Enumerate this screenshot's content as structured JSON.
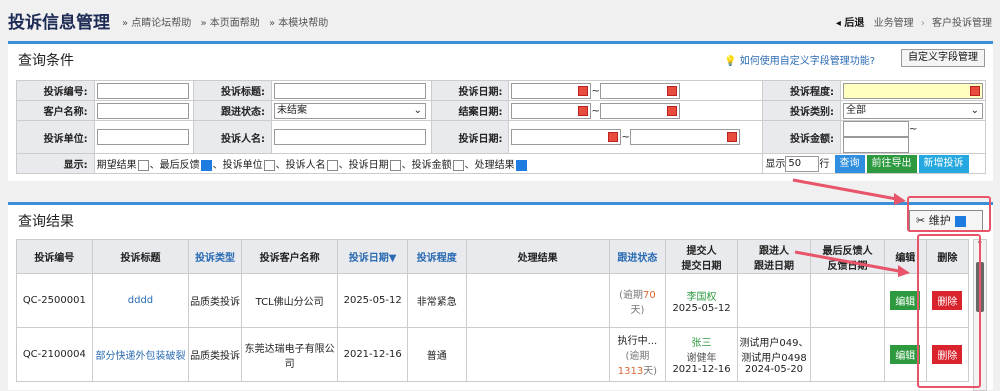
{
  "header": {
    "title": "投诉信息管理",
    "links": [
      "» 点睛论坛帮助",
      "» 本页面帮助",
      "» 本模块帮助"
    ],
    "back": "◂ 后退",
    "crumbs": [
      "业务管理",
      "客户投诉管理"
    ]
  },
  "query": {
    "title": "查询条件",
    "howto": "💡 如何使用自定义字段管理功能?",
    "custom_btn": "自定义字段管理",
    "labels": {
      "code": "投诉编号:",
      "subject": "投诉标题:",
      "date": "投诉日期:",
      "level": "投诉程度:",
      "customer": "客户名称:",
      "status": "跟进状态:",
      "close_date": "结案日期:",
      "type": "投诉类别:",
      "unit": "投诉单位:",
      "person": "投诉人名:",
      "date2": "投诉日期:",
      "amount": "投诉金额:",
      "display": "显示:"
    },
    "values": {
      "status": "未结案",
      "type": "全部",
      "tilde": "~"
    },
    "display_items": [
      {
        "label": "期望结果",
        "checked": false
      },
      {
        "label": "、最后反馈",
        "checked": true
      },
      {
        "label": "、投诉单位",
        "checked": false
      },
      {
        "label": "、投诉人名",
        "checked": false
      },
      {
        "label": "、投诉日期",
        "checked": false
      },
      {
        "label": "、投诉金额",
        "checked": false
      },
      {
        "label": "、处理结果",
        "checked": true
      }
    ],
    "show_prefix": "显示",
    "show_count": "50",
    "show_suffix": "行",
    "btn_query": "查询",
    "btn_export": "前往导出",
    "btn_new": "新增投诉"
  },
  "results": {
    "title": "查询结果",
    "maintain": "维护",
    "columns": [
      "投诉编号",
      "投诉标题",
      "投诉类型",
      "投诉客户名称",
      "投诉日期▼",
      "投诉程度",
      "处理结果",
      "跟进状态",
      "提交人\n提交日期",
      "跟进人\n跟进日期",
      "最后反馈人\n反馈日期",
      "编辑",
      "删除"
    ],
    "rows": [
      {
        "code": "QC-2500001",
        "subject": "dddd",
        "type": "品质类投诉",
        "customer": "TCL佛山分公司",
        "date": "2025-05-12",
        "level": "非常紧急",
        "result": "",
        "status_a": "(逾期",
        "status_n": "70",
        "status_b": "天)",
        "submitter": "李国权",
        "submit_date": "2025-05-12",
        "follower": "",
        "feedback": "",
        "edit": "编辑",
        "del": "删除"
      },
      {
        "code": "QC-2100004",
        "subject": "部分快递外包装破裂",
        "type": "品质类投诉",
        "customer": "东莞达瑞电子有限公司",
        "date": "2021-12-16",
        "level": "普通",
        "result": "",
        "status_pre": "执行中...",
        "status_a": "(逾期",
        "status_n": "1313",
        "status_b": "天)",
        "submitter": "张三",
        "submitter2": "谢健年",
        "submit_date": "2021-12-16",
        "follower": "测试用户049、测试用户0498",
        "follow_date": "2024-05-20",
        "feedback": "",
        "edit": "编辑",
        "del": "删除"
      }
    ]
  },
  "colors": {
    "accent": "#3b8fd6",
    "annotation": "#e8546a"
  }
}
